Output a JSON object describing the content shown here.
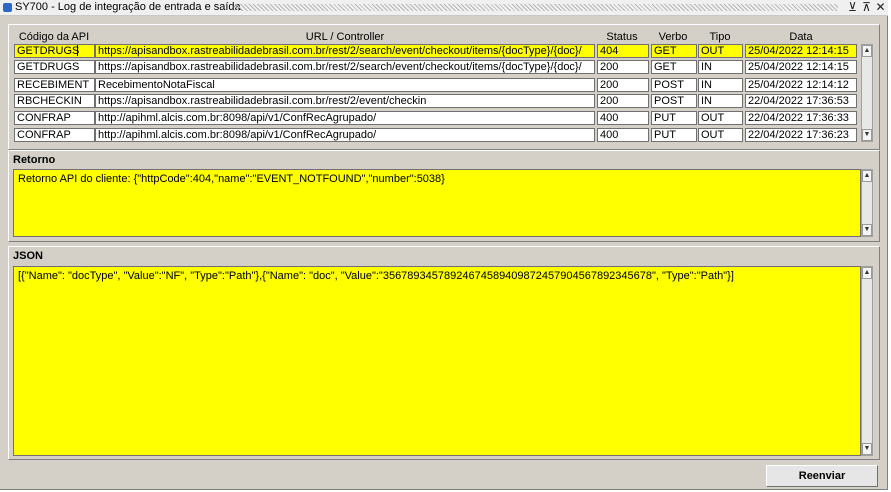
{
  "window": {
    "title": "SY700 - Log de integração de entrada e saída",
    "minimize_glyph": "⊻",
    "maximize_glyph": "⊼",
    "close_glyph": "✕"
  },
  "table": {
    "columns": [
      "Código da API",
      "URL / Controller",
      "Status",
      "Verbo",
      "Tipo",
      "Data"
    ],
    "rows": [
      {
        "api": "GETDRUGS",
        "url": "https://apisandbox.rastreabilidadebrasil.com.br/rest/2/search/event/checkout/items/{docType}/{doc}/",
        "status": "404",
        "verbo": "GET",
        "tipo": "OUT",
        "data": "25/04/2022 12:14:15"
      },
      {
        "api": "GETDRUGS",
        "url": "https://apisandbox.rastreabilidadebrasil.com.br/rest/2/search/event/checkout/items/{docType}/{doc}/",
        "status": "200",
        "verbo": "GET",
        "tipo": "IN",
        "data": "25/04/2022 12:14:15"
      },
      {
        "api": "RECEBIMENT",
        "url": "RecebimentoNotaFiscal",
        "status": "200",
        "verbo": "POST",
        "tipo": "IN",
        "data": "25/04/2022 12:14:12"
      },
      {
        "api": "RBCHECKIN",
        "url": "https://apisandbox.rastreabilidadebrasil.com.br/rest/2/event/checkin",
        "status": "200",
        "verbo": "POST",
        "tipo": "IN",
        "data": "22/04/2022 17:36:53"
      },
      {
        "api": "CONFRAP",
        "url": "http://apihml.alcis.com.br:8098/api/v1/ConfRecAgrupado/",
        "status": "400",
        "verbo": "PUT",
        "tipo": "OUT",
        "data": "22/04/2022 17:36:33"
      },
      {
        "api": "CONFRAP",
        "url": "http://apihml.alcis.com.br:8098/api/v1/ConfRecAgrupado/",
        "status": "400",
        "verbo": "PUT",
        "tipo": "OUT",
        "data": "22/04/2022 17:36:23"
      }
    ]
  },
  "retorno": {
    "label": "Retorno",
    "value": "Retorno API do cliente: {\"httpCode\":404,\"name\":\"EVENT_NOTFOUND\",\"number\":5038}"
  },
  "json_section": {
    "label": "JSON",
    "value": "[{\"Name\": \"docType\", \"Value\":\"NF\", \"Type\":\"Path\"},{\"Name\": \"doc\", \"Value\":\"3567893457892467458940987245790456789234567​8\", \"Type\":\"Path\"}]"
  },
  "buttons": {
    "reenviar": "Reenviar"
  },
  "colors": {
    "highlight": "#ffff00",
    "window_bg": "#d4d0c8"
  },
  "icons": {
    "scroll_up": "▲",
    "scroll_down": "▼"
  }
}
